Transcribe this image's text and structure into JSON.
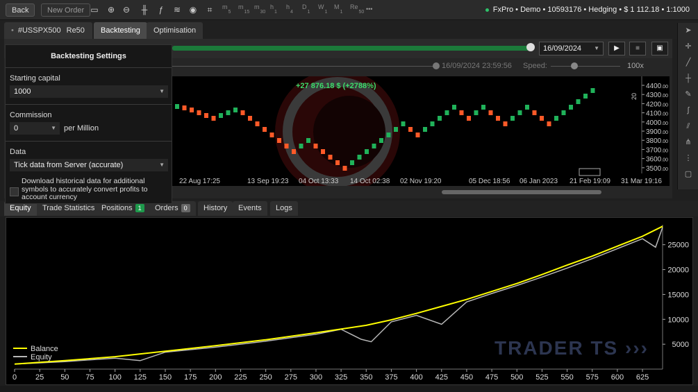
{
  "toolbar": {
    "back_label": "Back",
    "new_order_label": "New Order",
    "timeframes": [
      {
        "letter": "m",
        "sub": "5"
      },
      {
        "letter": "m",
        "sub": "15"
      },
      {
        "letter": "m",
        "sub": "30"
      },
      {
        "letter": "h",
        "sub": "1"
      },
      {
        "letter": "h",
        "sub": "4"
      },
      {
        "letter": "D",
        "sub": "1"
      },
      {
        "letter": "W",
        "sub": "1"
      },
      {
        "letter": "M",
        "sub": "1"
      },
      {
        "letter": "Re",
        "sub": "50"
      }
    ],
    "more_label": "•••",
    "account": "FxPro • Demo • 10593176 • Hedging • $ 1 112.18 • 1:1000"
  },
  "tabs": {
    "symbol": "#USSPX500",
    "period": "Re50",
    "backtesting": "Backtesting",
    "optimisation": "Optimisation"
  },
  "controls": {
    "end_date": "16/09/2024",
    "end_time": "16/09/2024 23:59:56",
    "speed_label": "Speed:",
    "speed_value": "100x"
  },
  "chart": {
    "profit_label": "+27 876.18 $ (+2788%)",
    "price_ticks": [
      "4400.00",
      "4300.00",
      "4200.00",
      "4100.00",
      "4000.00",
      "3900.00",
      "3800.00",
      "3700.00",
      "3600.00",
      "3500.00"
    ],
    "time_ticks": [
      "22 Aug 17:25",
      "13 Sep 19:23",
      "04 Oct 13:33",
      "14 Oct 02:38",
      "02 Nov 19:20",
      "05 Dec 18:56",
      "06 Jan 2023",
      "21 Feb 19:09",
      "31 Mar 19:16"
    ],
    "scale_marker": "20",
    "bull_color": "#20b25a",
    "bear_color": "#ff5a28"
  },
  "settings": {
    "title": "Backtesting Settings",
    "starting_capital_label": "Starting capital",
    "starting_capital_value": "1000",
    "commission_label": "Commission",
    "commission_value": "0",
    "commission_unit": "per Million",
    "data_label": "Data",
    "data_value": "Tick data from Server (accurate)",
    "download_label": "Download historical data for additional symbols to accurately convert profits to account currency"
  },
  "bottom_tabs": {
    "equity": "Equity",
    "trade_statistics": "Trade Statistics",
    "positions": "Positions",
    "positions_count": "1",
    "orders": "Orders",
    "orders_count": "0",
    "history": "History",
    "events": "Events",
    "logs": "Logs"
  },
  "chart_data": {
    "type": "line",
    "title": "",
    "legend": [
      "Balance",
      "Equity"
    ],
    "legend_position": "bottom-left",
    "xlim": [
      0,
      645
    ],
    "ylim": [
      0,
      29000
    ],
    "x_ticks": [
      0,
      25,
      50,
      75,
      100,
      125,
      150,
      175,
      200,
      225,
      250,
      275,
      300,
      325,
      350,
      375,
      400,
      425,
      450,
      475,
      500,
      525,
      550,
      575,
      600,
      625
    ],
    "y_ticks": [
      5000,
      10000,
      15000,
      20000,
      25000
    ],
    "series": [
      {
        "name": "Balance",
        "color": "#ffff00",
        "x": [
          0,
          50,
          100,
          150,
          200,
          250,
          300,
          350,
          375,
          400,
          425,
          450,
          475,
          500,
          525,
          550,
          575,
          600,
          625,
          645
        ],
        "values": [
          1000,
          1700,
          2500,
          3600,
          4700,
          5900,
          7300,
          8800,
          9900,
          11200,
          12600,
          14000,
          15600,
          17200,
          19000,
          20900,
          22700,
          24700,
          26700,
          28700
        ]
      },
      {
        "name": "Equity",
        "color": "#b8b8b8",
        "x": [
          0,
          50,
          100,
          125,
          150,
          200,
          250,
          300,
          325,
          345,
          355,
          375,
          400,
          425,
          450,
          475,
          500,
          525,
          550,
          575,
          600,
          625,
          638,
          645
        ],
        "values": [
          1000,
          1500,
          2200,
          1700,
          3400,
          4400,
          5600,
          7000,
          8000,
          6000,
          5500,
          9500,
          10800,
          9000,
          13500,
          15200,
          16800,
          18500,
          20300,
          22200,
          24200,
          26200,
          24500,
          28500
        ]
      }
    ]
  }
}
